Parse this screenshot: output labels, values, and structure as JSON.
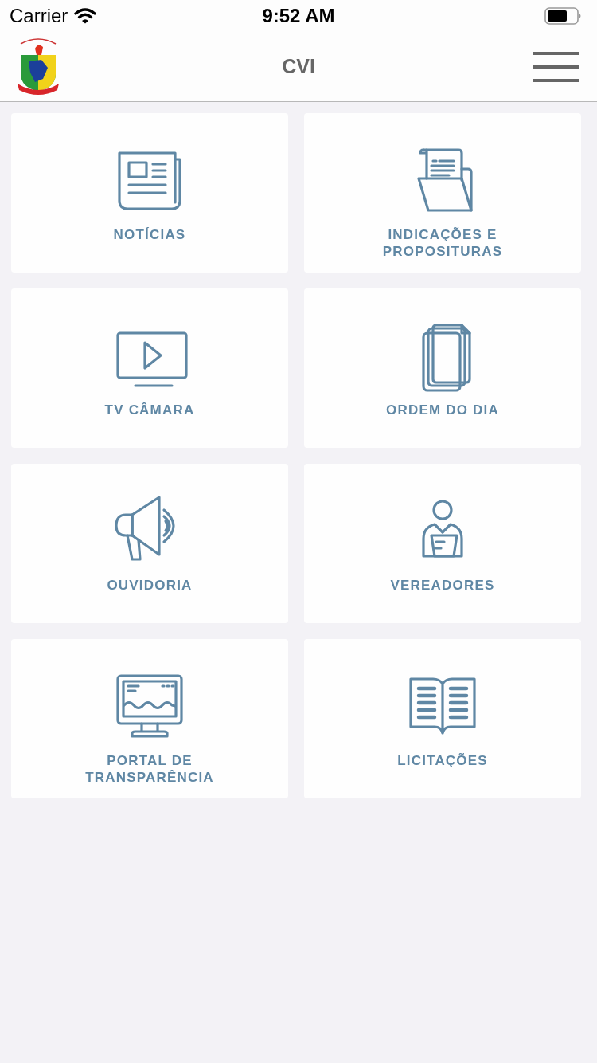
{
  "status_bar": {
    "carrier": "Carrier",
    "time": "9:52 AM"
  },
  "nav_bar": {
    "title": "CVI"
  },
  "menu_items": [
    {
      "label": "NOTÍCIAS",
      "kind": "news"
    },
    {
      "label": "INDICAÇÕES E PROPOSITURAS",
      "kind": "folder"
    },
    {
      "label": "TV CÂMARA",
      "kind": "tv"
    },
    {
      "label": "ORDEM DO DIA",
      "kind": "docs"
    },
    {
      "label": "OUVIDORIA",
      "kind": "megaphone"
    },
    {
      "label": "VEREADORES",
      "kind": "person"
    },
    {
      "label": "PORTAL DE TRANSPARÊNCIA",
      "kind": "monitor"
    },
    {
      "label": "LICITAÇÕES",
      "kind": "book"
    }
  ]
}
